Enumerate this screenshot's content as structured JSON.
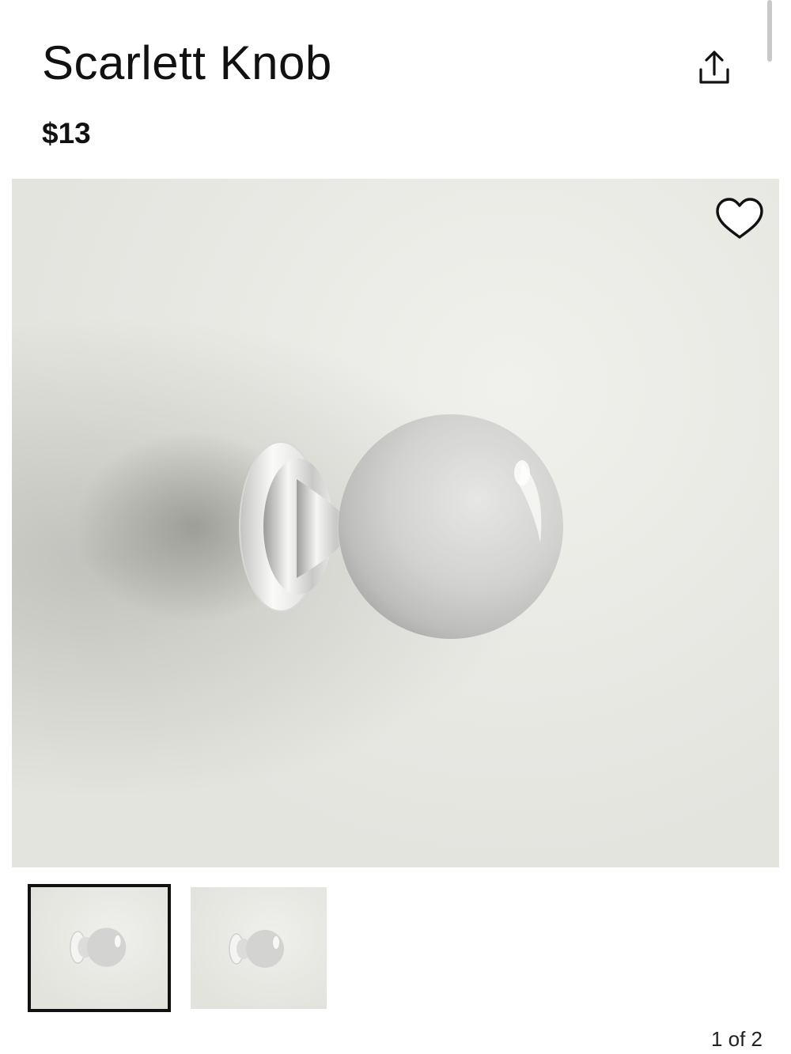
{
  "product": {
    "title": "Scarlett Knob",
    "price": "$13"
  },
  "actions": {
    "share_icon": "share-icon",
    "favorite_icon": "heart-outline-icon"
  },
  "gallery": {
    "current": 1,
    "total": 2,
    "pager_text": "1 of 2",
    "selected_thumbnail": 1
  },
  "colors": {
    "text": "#111111",
    "background": "#ffffff",
    "selected_border": "#111111"
  }
}
